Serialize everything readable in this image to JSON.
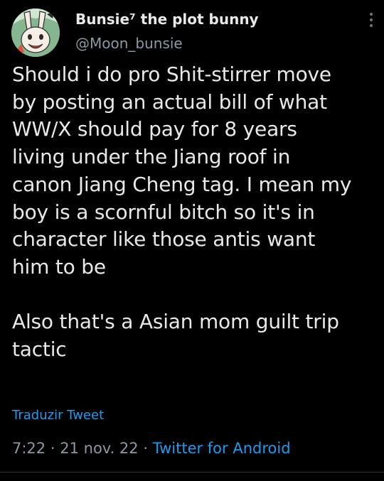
{
  "author": {
    "display_name": "Bunsie⁷ the plot bunny",
    "handle": "@Moon_bunsie",
    "avatar_icon": "bunny-avatar-icon"
  },
  "menu": {
    "icon": "more-vertical-icon"
  },
  "tweet": {
    "text": "Should i do pro Shit-stirrer move\nby posting an actual bill of what\nWW/X should pay for 8 years\nliving under the Jiang roof in\ncanon Jiang Cheng tag. I mean my\nboy is a scornful bitch so it's in\ncharacter like those antis want\nhim to be\n\nAlso that's a Asian mom guilt trip\ntactic",
    "translate_label": "Traduzir Tweet",
    "time": "7:22",
    "separator": "·",
    "date": "21 nov. 22",
    "source": "Twitter for Android"
  },
  "colors": {
    "background": "#000000",
    "primary_text": "#e7e9ea",
    "secondary_text": "#8b98a5",
    "link": "#1d9bf0"
  }
}
